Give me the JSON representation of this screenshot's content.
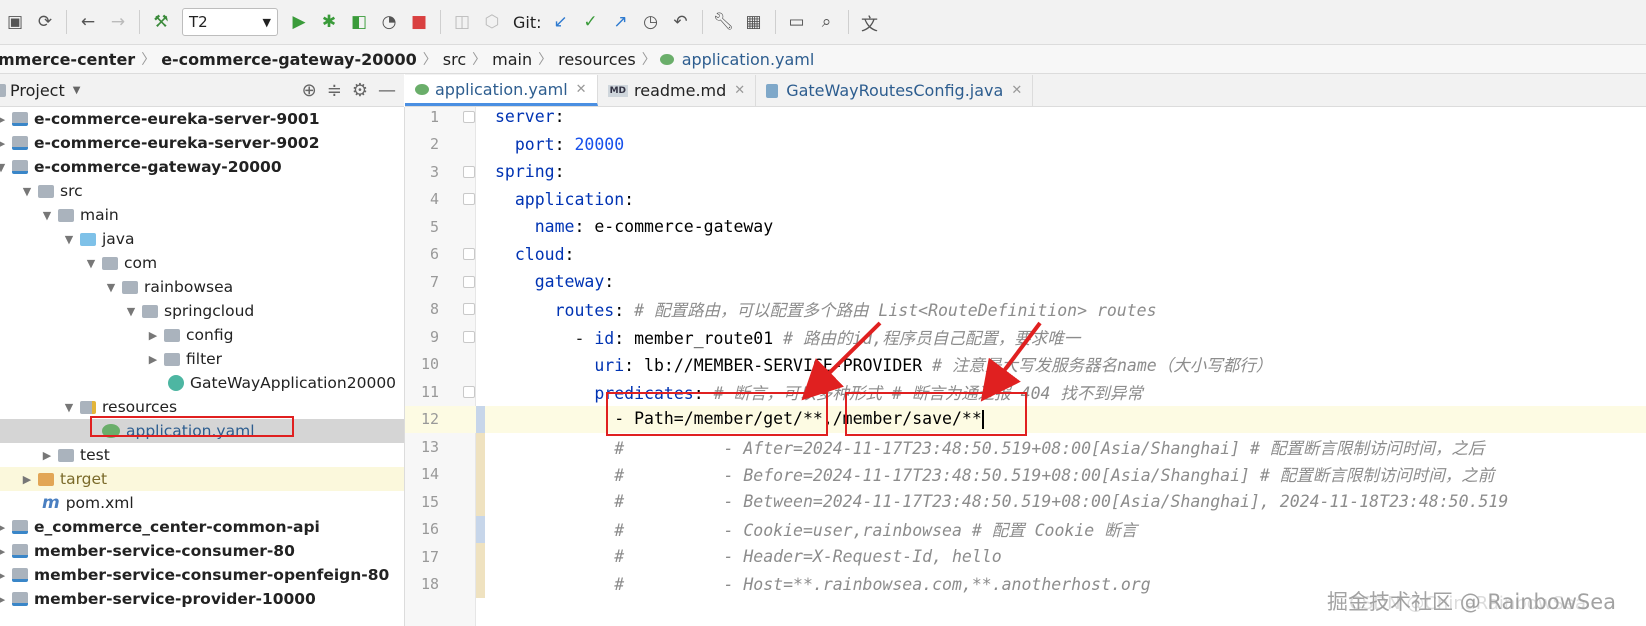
{
  "toolbar": {
    "run_config": "T2",
    "git_label": "Git:"
  },
  "breadcrumb": {
    "items": [
      "mmerce-center",
      "e-commerce-gateway-20000",
      "src",
      "main",
      "resources",
      "application.yaml"
    ]
  },
  "project": {
    "title": "Project",
    "tree": [
      {
        "label": "e-commerce-eureka-server-9001"
      },
      {
        "label": "e-commerce-eureka-server-9002"
      },
      {
        "label": "e-commerce-gateway-20000"
      },
      {
        "label": "src"
      },
      {
        "label": "main"
      },
      {
        "label": "java"
      },
      {
        "label": "com"
      },
      {
        "label": "rainbowsea"
      },
      {
        "label": "springcloud"
      },
      {
        "label": "config"
      },
      {
        "label": "filter"
      },
      {
        "label": "GateWayApplication20000"
      },
      {
        "label": "resources"
      },
      {
        "label": "application.yaml"
      },
      {
        "label": "test"
      },
      {
        "label": "target"
      },
      {
        "label": "pom.xml"
      },
      {
        "label": "e_commerce_center-common-api"
      },
      {
        "label": "member-service-consumer-80"
      },
      {
        "label": "member-service-consumer-openfeign-80"
      },
      {
        "label": "member-service-provider-10000"
      }
    ]
  },
  "tabs": [
    {
      "label": "application.yaml"
    },
    {
      "label": "readme.md"
    },
    {
      "label": "GateWayRoutesConfig.java"
    }
  ],
  "editor": {
    "lines": [
      {
        "num": "1",
        "parts": [
          {
            "t": "server",
            "c": "k"
          },
          {
            "t": ":",
            "c": "p"
          }
        ]
      },
      {
        "num": "2",
        "parts": [
          {
            "t": "  "
          },
          {
            "t": "port",
            "c": "k"
          },
          {
            "t": ": ",
            "c": "p"
          },
          {
            "t": "20000",
            "c": "n"
          }
        ]
      },
      {
        "num": "3",
        "parts": [
          {
            "t": "spring",
            "c": "k"
          },
          {
            "t": ":",
            "c": "p"
          }
        ]
      },
      {
        "num": "4",
        "parts": [
          {
            "t": "  "
          },
          {
            "t": "application",
            "c": "k"
          },
          {
            "t": ":",
            "c": "p"
          }
        ]
      },
      {
        "num": "5",
        "parts": [
          {
            "t": "    "
          },
          {
            "t": "name",
            "c": "k"
          },
          {
            "t": ": e-commerce-gateway",
            "c": "p"
          }
        ]
      },
      {
        "num": "6",
        "parts": [
          {
            "t": "  "
          },
          {
            "t": "cloud",
            "c": "k"
          },
          {
            "t": ":",
            "c": "p"
          }
        ]
      },
      {
        "num": "7",
        "parts": [
          {
            "t": "    "
          },
          {
            "t": "gateway",
            "c": "k"
          },
          {
            "t": ":",
            "c": "p"
          }
        ]
      },
      {
        "num": "8",
        "parts": [
          {
            "t": "      "
          },
          {
            "t": "routes",
            "c": "k"
          },
          {
            "t": ": ",
            "c": "p"
          },
          {
            "t": "# 配置路由，可以配置多个路由 List<RouteDefinition> routes",
            "c": "c"
          }
        ]
      },
      {
        "num": "9",
        "parts": [
          {
            "t": "        - "
          },
          {
            "t": "id",
            "c": "k"
          },
          {
            "t": ": member_route01 ",
            "c": "p"
          },
          {
            "t": "# 路由的id,程序员自己配置，要求唯一",
            "c": "c"
          }
        ]
      },
      {
        "num": "10",
        "parts": [
          {
            "t": "          "
          },
          {
            "t": "uri",
            "c": "k"
          },
          {
            "t": ": lb://MEMBER-SERVICE-PROVIDER ",
            "c": "p"
          },
          {
            "t": "# 注意是大写发服务器名name（大小写都行）",
            "c": "c"
          }
        ]
      },
      {
        "num": "11",
        "parts": [
          {
            "t": "          "
          },
          {
            "t": "predicates",
            "c": "k"
          },
          {
            "t": ": ",
            "c": "p"
          },
          {
            "t": "# 断言，可以多种形式 # 断言为通过报 404 找不到异常",
            "c": "c"
          }
        ]
      },
      {
        "num": "12",
        "parts": [
          {
            "t": "            - Path=/member/get/**,/member/save/**",
            "c": "p"
          }
        ]
      },
      {
        "num": "13",
        "parts": [
          {
            "t": "            #          - After=2024-11-17T23:48:50.519+08:00[Asia/Shanghai] # 配置断言限制访问时间，之后",
            "c": "c"
          }
        ]
      },
      {
        "num": "14",
        "parts": [
          {
            "t": "            #          - Before=2024-11-17T23:48:50.519+08:00[Asia/Shanghai] # 配置断言限制访问时间，之前",
            "c": "c"
          }
        ]
      },
      {
        "num": "15",
        "parts": [
          {
            "t": "            #          - Between=2024-11-17T23:48:50.519+08:00[Asia/Shanghai], 2024-11-18T23:48:50.519",
            "c": "c"
          }
        ]
      },
      {
        "num": "16",
        "parts": [
          {
            "t": "            #          - Cookie=user,rainbowsea # 配置 Cookie 断言",
            "c": "c"
          }
        ]
      },
      {
        "num": "17",
        "parts": [
          {
            "t": "            #          - Header=X-Request-Id, hello",
            "c": "c"
          }
        ]
      },
      {
        "num": "18",
        "parts": [
          {
            "t": "            #          - Host=**.rainbowsea.com,**.anotherhost.org",
            "c": "c"
          }
        ]
      }
    ]
  },
  "watermark": "掘金技术社区 @ RainbowSea",
  "watermark_secondary": "CSDN @ChinaRainbowSea",
  "colors": {
    "annotation_red": "#e02020",
    "keyword": "#0033b3",
    "comment": "#8c8c8c",
    "number": "#1750eb"
  }
}
